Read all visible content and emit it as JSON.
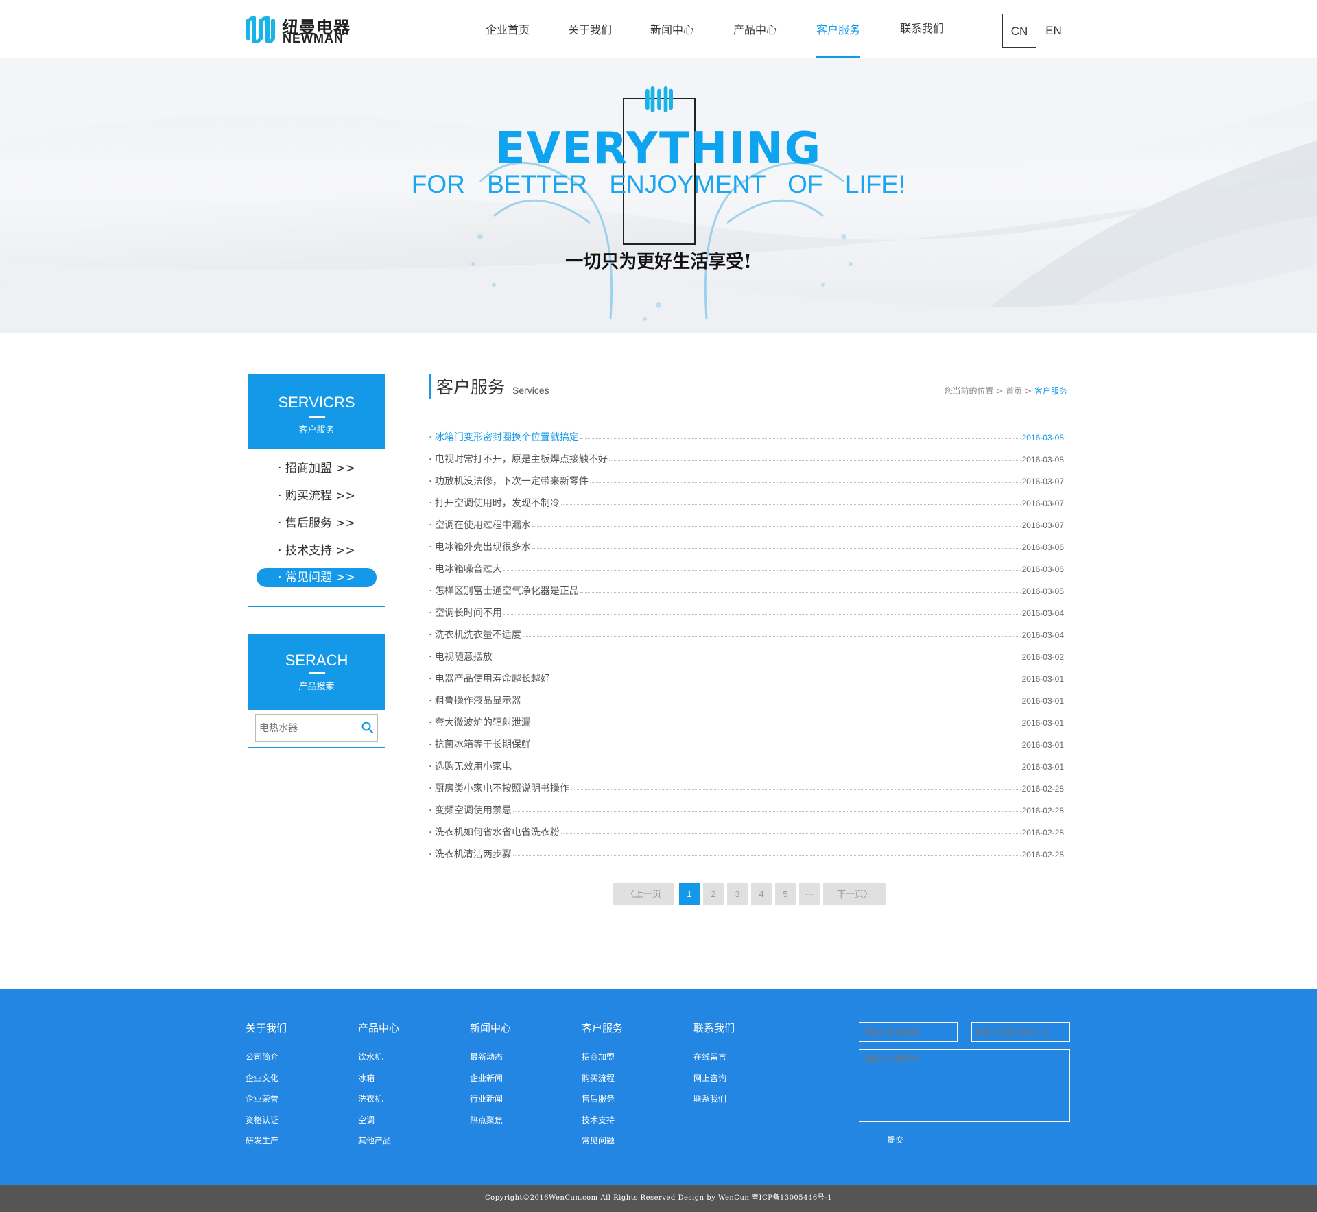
{
  "header": {
    "brand_cn": "纽曼电器",
    "brand_en": "NEWMAN",
    "nav": [
      {
        "label": "企业首页"
      },
      {
        "label": "关于我们"
      },
      {
        "label": "新闻中心"
      },
      {
        "label": "产品中心"
      },
      {
        "label": "客户服务"
      },
      {
        "label": "联系我们"
      }
    ],
    "active_nav": "客户服务",
    "lang_cn": "CN",
    "lang_en": "EN"
  },
  "banner": {
    "headline": "EVERYTHING",
    "tagline": "FOR BETTER ENJOYMENT OF LIFE!",
    "slogan": "一切只为更好生活享受!"
  },
  "sidebar": {
    "services": {
      "title": "SERVICRS",
      "subtitle": "客户服务",
      "items": [
        {
          "label": "· 招商加盟 >>"
        },
        {
          "label": "· 购买流程 >>"
        },
        {
          "label": "· 售后服务 >>"
        },
        {
          "label": "· 技术支持 >>"
        },
        {
          "label": "· 常见问题 >>"
        }
      ],
      "selected": "· 常见问题 >>"
    },
    "search": {
      "title": "SERACH",
      "subtitle": "产品搜索",
      "placeholder": "电热水器"
    }
  },
  "main": {
    "title": "客户服务",
    "title_en": "Services",
    "breadcrumb": {
      "prefix": "您当前的位置",
      "home": "首页",
      "current": "客户服务",
      "sep": ">"
    },
    "articles": [
      {
        "title": "· 冰箱门变形密封圈换个位置就搞定",
        "date": "2016-03-08"
      },
      {
        "title": "· 电视时常打不开，原是主板焊点接触不好",
        "date": "2016-03-08"
      },
      {
        "title": "· 功放机没法修，下次一定带来新零件",
        "date": "2016-03-07"
      },
      {
        "title": "· 打开空调使用时，发现不制冷",
        "date": "2016-03-07"
      },
      {
        "title": "· 空调在使用过程中漏水",
        "date": "2016-03-07"
      },
      {
        "title": "· 电冰箱外壳出现很多水",
        "date": "2016-03-06"
      },
      {
        "title": "· 电冰箱噪音过大",
        "date": "2016-03-06"
      },
      {
        "title": "· 怎样区别富士通空气净化器是正品",
        "date": "2016-03-05"
      },
      {
        "title": "· 空调长时间不用",
        "date": "2016-03-04"
      },
      {
        "title": "· 洗衣机洗衣量不适度",
        "date": "2016-03-04"
      },
      {
        "title": "· 电视随意摆放",
        "date": "2016-03-02"
      },
      {
        "title": "· 电器产品使用寿命越长越好",
        "date": "2016-03-01"
      },
      {
        "title": "· 粗鲁操作液晶显示器",
        "date": "2016-03-01"
      },
      {
        "title": "· 夸大微波炉的辐射泄漏",
        "date": "2016-03-01"
      },
      {
        "title": "· 抗菌冰箱等于长期保鲜",
        "date": "2016-03-01"
      },
      {
        "title": "· 选购无效用小家电",
        "date": "2016-03-01"
      },
      {
        "title": "· 厨房类小家电不按照说明书操作",
        "date": "2016-02-28"
      },
      {
        "title": "· 变频空调使用禁忌",
        "date": "2016-02-28"
      },
      {
        "title": "· 洗衣机如何省水省电省洗衣粉",
        "date": "2016-02-28"
      },
      {
        "title": "· 洗衣机清洁两步骤",
        "date": "2016-02-28"
      }
    ],
    "pagination": {
      "prev": "上一页",
      "pages": [
        "1",
        "2",
        "3",
        "4",
        "5"
      ],
      "ellipsis": "···",
      "next": "下一页",
      "current": "1"
    }
  },
  "footer": {
    "columns": [
      {
        "heading": "关于我们",
        "links": [
          "公司简介",
          "企业文化",
          "企业荣誉",
          "资格认证",
          "研发生产"
        ]
      },
      {
        "heading": "产品中心",
        "links": [
          "饮水机",
          "冰箱",
          "洗衣机",
          "空调",
          "其他产品"
        ]
      },
      {
        "heading": "新闻中心",
        "links": [
          "最新动态",
          "企业新闻",
          "行业新闻",
          "热点聚焦"
        ]
      },
      {
        "heading": "客户服务",
        "links": [
          "招商加盟",
          "购买流程",
          "售后服务",
          "技术支持",
          "常见问题"
        ]
      },
      {
        "heading": "联系我们",
        "links": [
          "在线留言",
          "网上咨询",
          "联系我们"
        ]
      }
    ],
    "form": {
      "name_placeholder": "请输入您的姓名",
      "contact_placeholder": "请输入您的联系方式",
      "message_placeholder": "请输入您的留言",
      "submit": "提交"
    },
    "copyright": "Copyright©2016WenCun.com All Rights Reserved Design by WenCun 粤ICP备13005446号-1"
  },
  "colors": {
    "accent": "#1499e8",
    "footer_bg": "#2386e3",
    "copyright_bg": "#555555"
  }
}
